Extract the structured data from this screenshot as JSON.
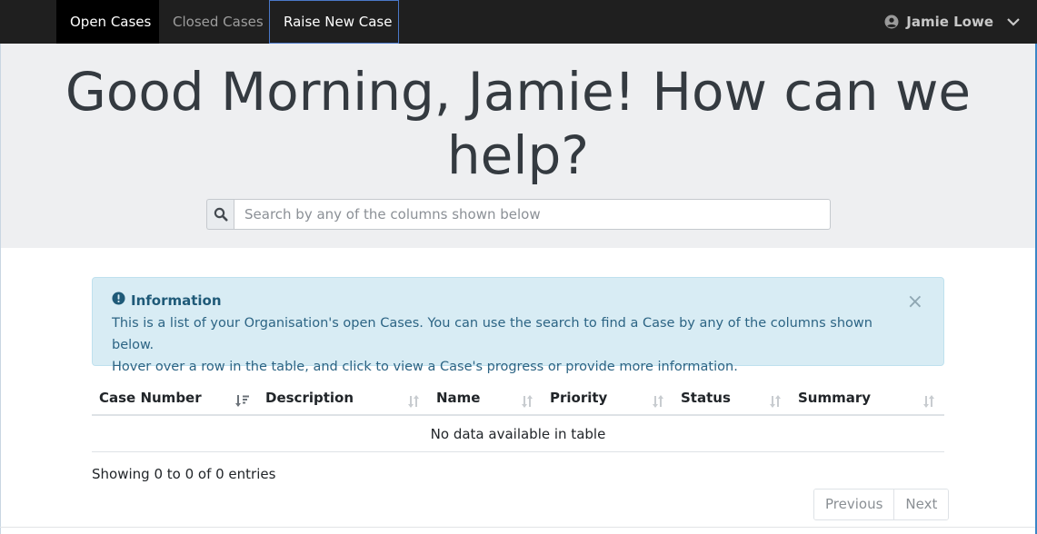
{
  "navbar": {
    "tabs": [
      {
        "label": "Open Cases"
      },
      {
        "label": "Closed Cases"
      },
      {
        "label": "Raise New Case"
      }
    ],
    "user": {
      "name": "Jamie Lowe",
      "icon": "user-circle-icon",
      "caret": "chevron-down-icon"
    }
  },
  "hero": {
    "title_line1": "Good Morning, Jamie! How can we",
    "title_line2": "help?",
    "search": {
      "icon": "search-icon",
      "placeholder": "Search by any of the columns shown below",
      "value": ""
    }
  },
  "alert": {
    "icon": "exclamation-circle-icon",
    "title": "Information",
    "line1": "This is a list of your Organisation's open Cases. You can use the search to find a Case by any of the columns shown below.",
    "line2": "Hover over a row in the table, and click to view a Case's progress or provide more information.",
    "close": "×"
  },
  "table": {
    "columns": [
      {
        "label": "Case Number",
        "sort": "sort-desc-icon"
      },
      {
        "label": "Description",
        "sort": "sort-icon"
      },
      {
        "label": "Name",
        "sort": "sort-icon"
      },
      {
        "label": "Priority",
        "sort": "sort-icon"
      },
      {
        "label": "Status",
        "sort": "sort-icon"
      },
      {
        "label": "Summary",
        "sort": "sort-icon"
      }
    ],
    "empty_message": "No data available in table",
    "info": "Showing 0 to 0 of 0 entries"
  },
  "pagination": {
    "previous": "Previous",
    "next": "Next"
  },
  "colors": {
    "navbar": "#1f1f1f",
    "hero_bg": "#eeeff1",
    "alert_bg": "#d8ecf4",
    "accent": "#4a78c8"
  }
}
